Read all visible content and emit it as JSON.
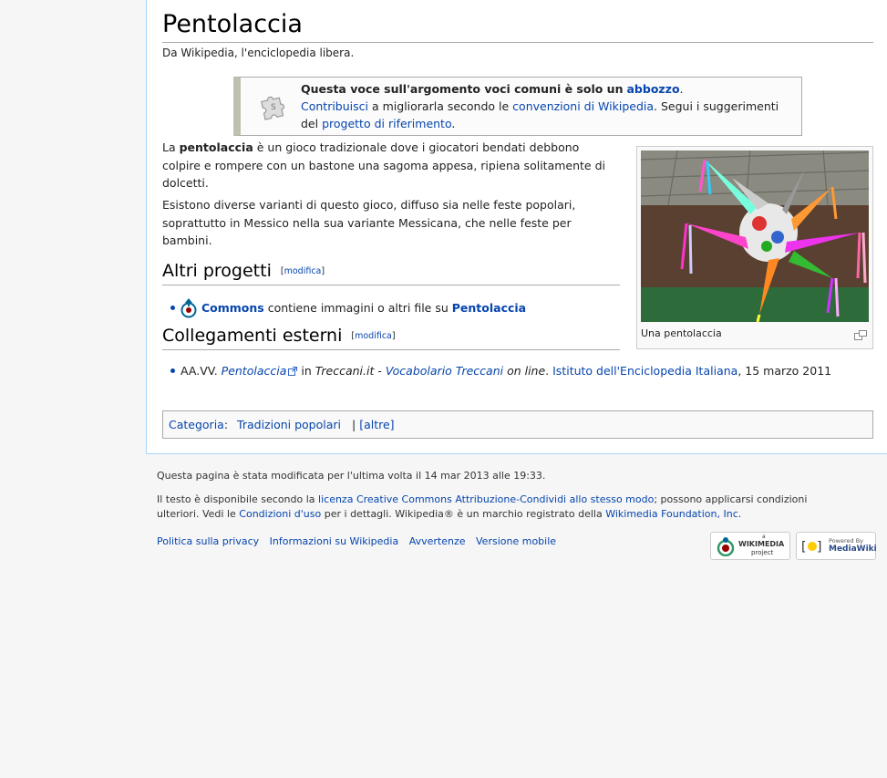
{
  "article": {
    "title": "Pentolaccia",
    "site_sub": "Da Wikipedia, l'enciclopedia libera."
  },
  "stub": {
    "bold_prefix": "Questa voce sull'argomento voci comuni è solo un",
    "bold_link": "abbozzo",
    "bold_suffix": ".",
    "contribute_link": "Contribuisci",
    "text_mid": " a migliorarla secondo le ",
    "conventions_link": "convenzioni di Wikipedia",
    "text_after": ". Segui i suggerimenti",
    "text_del": "del ",
    "project_link": "progetto di riferimento",
    "text_end": "."
  },
  "intro": {
    "p1_a": "La ",
    "p1_bold": "pentolaccia",
    "p1_b": " è un gioco tradizionale dove i giocatori bendati debbono colpire e rompere con un bastone una sagoma appesa, ripiena solitamente di dolcetti.",
    "p2": "Esistono diverse varianti di questo gioco, diffuso sia nelle feste popolari, soprattutto in Messico nella sua variante Messicana, che nelle feste per bambini."
  },
  "thumb": {
    "caption": "Una pentolaccia"
  },
  "sections": {
    "altri_progetti": "Altri progetti",
    "collegamenti": "Collegamenti esterni",
    "edit_label": "modifica",
    "edit_open": "[",
    "edit_close": "]"
  },
  "commons": {
    "link": "Commons",
    "text": " contiene immagini o altri file su ",
    "target": "Pentolaccia"
  },
  "external": {
    "authors": "AA.VV. ",
    "title_link": "Pentolaccia",
    "in": " in ",
    "site": "Treccani.it",
    "dash": " - ",
    "vocab_link": "Vocabolario Treccani",
    "online": " on line",
    "dot": ". ",
    "publisher_link": "Istituto dell'Enciclopedia Italiana",
    "date": ", 15 marzo 2011"
  },
  "categories": {
    "label": "Categoria",
    "colon": ":",
    "item": "Tradizioni popolari",
    "sep": "|",
    "others": "[altre]"
  },
  "footer": {
    "last_modified": "Questa pagina è stata modificata per l'ultima volta il 14 mar 2013 alle 19:33.",
    "license_a": "Il testo è disponibile secondo la ",
    "license_link": "licenza Creative Commons Attribuzione-Condividi allo stesso modo",
    "license_b": "; possono applicarsi condizioni ulteriori. Vedi le ",
    "terms_link": "Condizioni d'uso",
    "license_c": " per i dettagli. Wikipedia® è un marchio registrato della ",
    "wmf_link": "Wikimedia Foundation, Inc.",
    "license_d": "",
    "links": [
      "Politica sulla privacy",
      "Informazioni su Wikipedia",
      "Avvertenze",
      "Versione mobile"
    ],
    "wikimedia_badge_top": "a",
    "wikimedia_badge_main": "WIKIMEDIA",
    "wikimedia_badge_sub": "project",
    "mediawiki_badge_top": "Powered By",
    "mediawiki_badge_main": "MediaWiki"
  }
}
